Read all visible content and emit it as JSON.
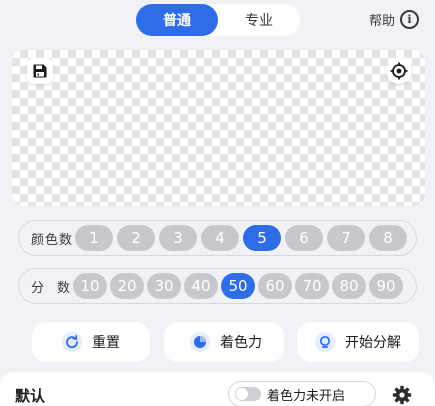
{
  "tabs": [
    {
      "label": "普通",
      "active": true
    },
    {
      "label": "专业",
      "active": false
    }
  ],
  "help": {
    "label": "帮助",
    "icon": "info-icon",
    "icon_glyph": "i"
  },
  "canvas": {
    "save_icon": "save-icon",
    "target_icon": "crosshair-icon",
    "checker_colors": [
      "#ffffff",
      "#e3e3e3"
    ]
  },
  "color_count": {
    "label": "颜色数",
    "options": [
      "1",
      "2",
      "3",
      "4",
      "5",
      "6",
      "7",
      "8"
    ],
    "selected": "5"
  },
  "parts": {
    "label": "分　数",
    "options": [
      "10",
      "20",
      "30",
      "40",
      "50",
      "60",
      "70",
      "80",
      "90"
    ],
    "selected": "50"
  },
  "actions": [
    {
      "label": "重置",
      "icon": "refresh-icon"
    },
    {
      "label": "着色力",
      "icon": "pie-chart-icon"
    },
    {
      "label": "开始分解",
      "icon": "bulb-icon"
    }
  ],
  "bottom": {
    "title": "默认",
    "toggle_label": "着色力未开启",
    "toggle_on": false,
    "settings_icon": "gear-icon"
  },
  "colors": {
    "accent": "#2f6de7",
    "pill_inactive": "#c7c8cc",
    "background": "#f1f2f6"
  }
}
